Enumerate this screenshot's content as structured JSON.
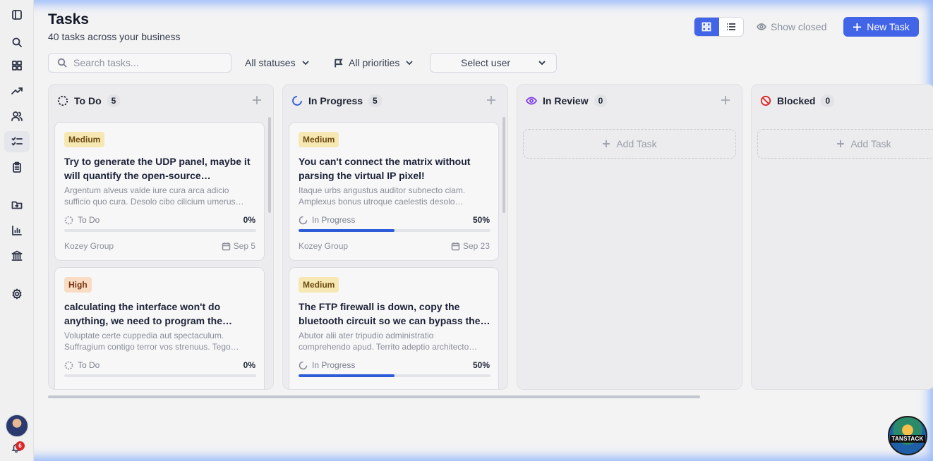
{
  "page": {
    "title": "Tasks",
    "subtitle": "40 tasks across your business"
  },
  "toolbar": {
    "show_closed": "Show closed",
    "new_task": "New Task"
  },
  "filters": {
    "search_placeholder": "Search tasks...",
    "status": "All statuses",
    "priority": "All priorities",
    "user": "Select user"
  },
  "sidebar": {
    "icons": [
      "sidebar-toggle-icon",
      "search-icon",
      "dashboard-icon",
      "trending-icon",
      "users-icon",
      "tasks-icon",
      "clipboard-icon",
      "folder-icon",
      "bar-chart-icon",
      "bank-icon",
      "settings-icon"
    ],
    "notification_count": "6"
  },
  "columns": [
    {
      "title": "To Do",
      "count": "5",
      "add_label": "Add Task",
      "cards": [
        {
          "priority": "Medium",
          "title": "Try to generate the UDP panel, maybe it will quantify the open-source…",
          "description": "Argentum alveus valde iure cura arca adicio sufficio quo cura. Desolo cibo cilicium umerus…",
          "status": "To Do",
          "progress_label": "0%",
          "progress": 0,
          "company": "Kozey Group",
          "date": "Sep 5"
        },
        {
          "priority": "High",
          "title": "calculating the interface won't do anything, we need to program the…",
          "description": "Voluptate certe cuppedia aut spectaculum. Suffragium contigo terror vos strenuus. Tego…",
          "status": "To Do",
          "progress_label": "0%",
          "progress": 0,
          "company": "",
          "date": ""
        }
      ]
    },
    {
      "title": "In Progress",
      "count": "5",
      "add_label": "Add Task",
      "cards": [
        {
          "priority": "Medium",
          "title": "You can't connect the matrix without parsing the virtual IP pixel!",
          "description": "Itaque urbs angustus auditor subnecto clam. Amplexus bonus utroque caelestis desolo…",
          "status": "In Progress",
          "progress_label": "50%",
          "progress": 0.5,
          "company": "Kozey Group",
          "date": "Sep 23"
        },
        {
          "priority": "Medium",
          "title": "The FTP firewall is down, copy the bluetooth circuit so we can bypass the…",
          "description": "Abutor alii ater tripudio administratio comprehendo apud. Territo adeptio architecto…",
          "status": "In Progress",
          "progress_label": "50%",
          "progress": 0.5,
          "company": "",
          "date": ""
        }
      ]
    },
    {
      "title": "In Review",
      "count": "0",
      "add_label": "Add Task",
      "cards": []
    },
    {
      "title": "Blocked",
      "count": "0",
      "add_label": "Add Task",
      "cards": []
    }
  ],
  "colors": {
    "accent": "#4264e6",
    "progress": "#2e5bd8",
    "review_icon": "#7c3aed",
    "blocked_icon": "#dc2626",
    "in_progress_icon": "#2e5bd8"
  },
  "brand": {
    "logo_text": "TANSTACK"
  }
}
